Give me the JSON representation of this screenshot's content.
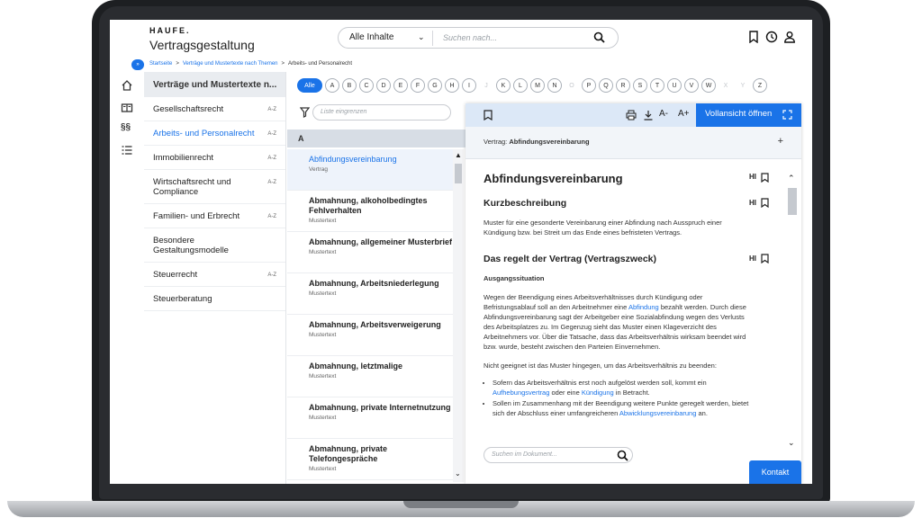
{
  "header": {
    "brand": "HAUFE.",
    "title": "Vertragsgestaltung",
    "search_select": "Alle Inhalte",
    "search_placeholder": "Suchen nach..."
  },
  "breadcrumb": {
    "toggle": "»",
    "items": [
      {
        "label": "Startseite",
        "link": true
      },
      {
        "label": ">",
        "link": false
      },
      {
        "label": "Verträge und Mustertexte nach Themen",
        "link": true
      },
      {
        "label": ">",
        "link": false
      },
      {
        "label": "Arbeits- und Personalrecht",
        "link": false
      }
    ]
  },
  "categories": {
    "heading": "Verträge und Mustertexte n...",
    "az": "A-Z",
    "items": [
      {
        "label": "Gesellschaftsrecht",
        "az": true,
        "active": false
      },
      {
        "label": "Arbeits- und Personalrecht",
        "az": true,
        "active": true
      },
      {
        "label": "Immobilienrecht",
        "az": true,
        "active": false
      },
      {
        "label": "Wirtschaftsrecht und Compliance",
        "az": true,
        "active": false
      },
      {
        "label": "Familien- und Erbrecht",
        "az": true,
        "active": false
      },
      {
        "label": "Besondere Gestaltungsmodelle",
        "az": false,
        "active": false
      },
      {
        "label": "Steuerrecht",
        "az": true,
        "active": false
      },
      {
        "label": "Steuerberatung",
        "az": false,
        "active": false
      }
    ]
  },
  "letters": [
    {
      "l": "Alle",
      "s": "all"
    },
    {
      "l": "A",
      "s": "on"
    },
    {
      "l": "B",
      "s": "on"
    },
    {
      "l": "C",
      "s": "on"
    },
    {
      "l": "D",
      "s": "on"
    },
    {
      "l": "E",
      "s": "on"
    },
    {
      "l": "F",
      "s": "on"
    },
    {
      "l": "G",
      "s": "on"
    },
    {
      "l": "H",
      "s": "on"
    },
    {
      "l": "I",
      "s": "on"
    },
    {
      "l": "J",
      "s": "off"
    },
    {
      "l": "K",
      "s": "on"
    },
    {
      "l": "L",
      "s": "on"
    },
    {
      "l": "M",
      "s": "on"
    },
    {
      "l": "N",
      "s": "on"
    },
    {
      "l": "O",
      "s": "off"
    },
    {
      "l": "P",
      "s": "on"
    },
    {
      "l": "Q",
      "s": "on"
    },
    {
      "l": "R",
      "s": "on"
    },
    {
      "l": "S",
      "s": "on"
    },
    {
      "l": "T",
      "s": "on"
    },
    {
      "l": "U",
      "s": "on"
    },
    {
      "l": "V",
      "s": "on"
    },
    {
      "l": "W",
      "s": "on"
    },
    {
      "l": "X",
      "s": "off"
    },
    {
      "l": "Y",
      "s": "off"
    },
    {
      "l": "Z",
      "s": "on"
    }
  ],
  "list": {
    "filter_placeholder": "Liste eingrenzen",
    "group": "A",
    "items": [
      {
        "title": "Abfindungsvereinbarung",
        "sub": "Vertrag",
        "sel": true
      },
      {
        "title": "Abmahnung, alkoholbedingtes Fehlverhalten",
        "sub": "Mustertext",
        "sel": false
      },
      {
        "title": "Abmahnung, allgemeiner Musterbrief",
        "sub": "Mustertext",
        "sel": false
      },
      {
        "title": "Abmahnung, Arbeitsniederlegung",
        "sub": "Mustertext",
        "sel": false
      },
      {
        "title": "Abmahnung, Arbeitsverweigerung",
        "sub": "Mustertext",
        "sel": false
      },
      {
        "title": "Abmahnung, letztmalige",
        "sub": "Mustertext",
        "sel": false
      },
      {
        "title": "Abmahnung, private Internetnutzung",
        "sub": "Mustertext",
        "sel": false
      },
      {
        "title": "Abmahnung, private Telefongespräche",
        "sub": "Mustertext",
        "sel": false
      }
    ]
  },
  "doc": {
    "full_view": "Vollansicht öffnen",
    "path_prefix": "Vertrag:",
    "path_title": "Abfindungsvereinbarung",
    "title": "Abfindungsvereinbarung",
    "hi": "HI",
    "s1_title": "Kurzbeschreibung",
    "s1_text": "Muster für eine gesonderte Vereinbarung einer Abfindung nach Ausspruch einer Kündigung bzw. bei Streit um das Ende eines befristeten Vertrags.",
    "s2_title": "Das regelt der Vertrag (Vertragszweck)",
    "sub1": "Ausgangssituation",
    "p1a": "Wegen der Beendigung eines Arbeitsverhältnisses durch Kündigung oder Befristungsablauf soll an den Arbeitnehmer eine ",
    "p1_link": "Abfindung",
    "p1b": " bezahlt werden. Durch diese Abfindungsvereinbarung sagt der Arbeitgeber eine Sozialabfindung wegen des Verlusts des Arbeitsplatzes zu. Im Gegenzug sieht das Muster einen Klageverzicht des Arbeitnehmers vor. Über die Tatsache, dass das Arbeitsverhältnis wirksam beendet wird bzw. wurde, besteht zwischen den Parteien Einvernehmen.",
    "p2": "Nicht geeignet ist das Muster hingegen, um das Arbeitsverhältnis zu beenden:",
    "b1a": "Sofern das Arbeitsverhältnis erst noch aufgelöst werden soll, kommt ein ",
    "b1_link1": "Aufhebungsvertrag",
    "b1b": " oder eine ",
    "b1_link2": "Kündigung",
    "b1c": " in Betracht.",
    "b2a": "Sollen im Zusammenhang mit der Beendigung weitere Punkte geregelt werden, bietet sich der Abschluss einer umfangreicheren ",
    "b2_link": "Abwicklungsvereinbarung",
    "b2b": " an.",
    "search_placeholder": "Suchen im Dokument..."
  },
  "kontakt": "Kontakt",
  "colors": {
    "accent": "#1a73e8"
  }
}
